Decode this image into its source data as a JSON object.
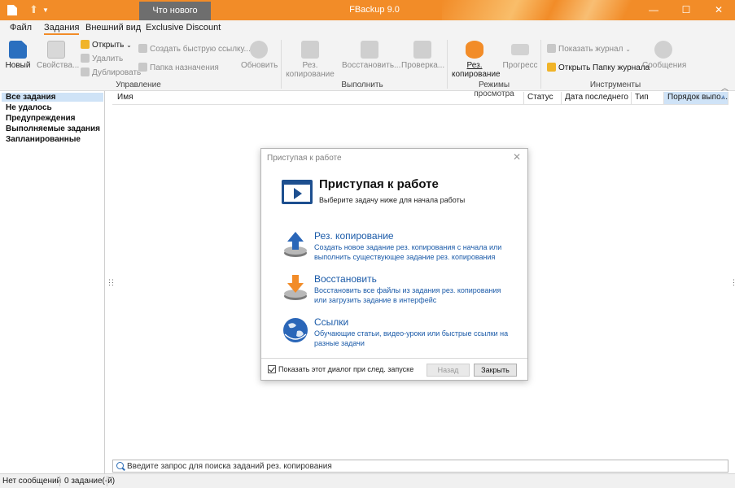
{
  "titlebar": {
    "title": "FBackup 9.0",
    "whats_new": "Что нового",
    "minimize": "—",
    "maximize": "☐",
    "close": "✕",
    "accent": "#f28c28"
  },
  "tabs": [
    "Файл",
    "Задания",
    "Внешний вид",
    "Exclusive Discount"
  ],
  "ribbon": {
    "manage": {
      "label": "Управление",
      "new": "Новый",
      "properties": "Свойства...",
      "open": "Открыть",
      "delete": "Удалить",
      "duplicate": "Дублировать",
      "quick_link": "Создать быструю ссылку...",
      "dest_folder": "Папка назначения",
      "refresh": "Обновить"
    },
    "execute": {
      "label": "Выполнить",
      "backup_line1": "Рез.",
      "backup_line2": "копирование",
      "restore": "Восстановить...",
      "check": "Проверка..."
    },
    "view_modes": {
      "label": "Режимы просмотра",
      "backup_line1": "Рез.",
      "backup_line2": "копирование",
      "progress": "Прогресс"
    },
    "tools": {
      "label": "Инструменты",
      "show_log": "Показать журнал",
      "open_log_folder": "Открыть Папку журнала",
      "messages": "Сообщения"
    }
  },
  "categories": [
    "Все задания",
    "Не удалось",
    "Предупреждения",
    "Выполняемые задания",
    "Запланированные"
  ],
  "columns": [
    "Имя",
    "Статус",
    "Дата последнего ...",
    "Тип",
    "Порядок выпо..."
  ],
  "search": {
    "placeholder": "Введите запрос для поиска заданий рез. копирования"
  },
  "status": {
    "messages": "Нет сообщений",
    "jobs": "0 задание(-й)"
  },
  "dialog": {
    "window_title": "Приступая к работе",
    "heading": "Приступая к работе",
    "subheading": "Выберите задачу ниже для начала работы",
    "items": [
      {
        "title": "Рез. копирование",
        "desc": "Создать новое задание рез. копирования с начала или выполнить существующее задание рез. копирования",
        "icon": "backup-upload-icon"
      },
      {
        "title": "Восстановить",
        "desc": "Восстановить все файлы из задания рез. копирования или загрузить задание в интерфейс",
        "icon": "restore-download-icon"
      },
      {
        "title": "Ссылки",
        "desc": "Обучающие статьи, видео-уроки или быстрые ссылки на разные задачи",
        "icon": "globe-links-icon"
      }
    ],
    "show_on_startup": "Показать этот диалог при след. запуске",
    "back": "Назад",
    "close": "Закрыть"
  }
}
